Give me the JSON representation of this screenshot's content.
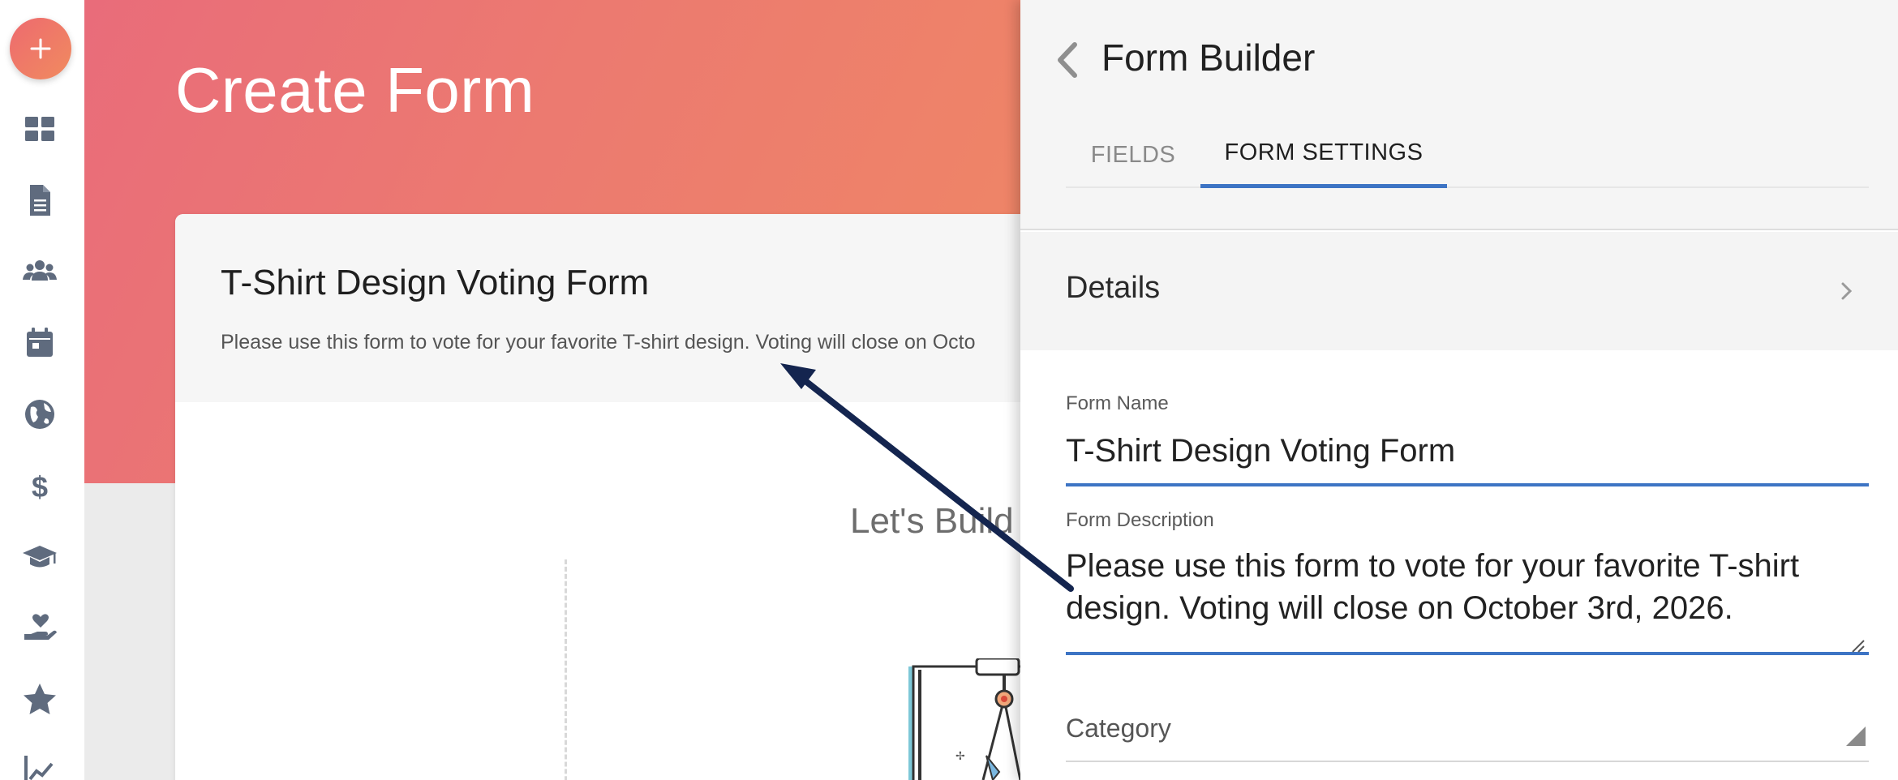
{
  "main": {
    "hero_title": "Create Form",
    "card_title": "T-Shirt Design Voting Form",
    "card_description": "Please use this form to vote for your favorite T-shirt design. Voting will close on Octo",
    "lets_build": "Let's Build"
  },
  "panel": {
    "title": "Form Builder",
    "tabs": [
      {
        "label": "FIELDS",
        "active": false
      },
      {
        "label": "FORM SETTINGS",
        "active": true
      }
    ],
    "details_label": "Details",
    "form_name_label": "Form Name",
    "form_name_value": "T-Shirt Design Voting Form",
    "form_description_label": "Form Description",
    "form_description_value": "Please use this form to vote for your favorite T-shirt design. Voting will close on October 3rd, 2026.",
    "category_label": "Category"
  },
  "rail": {
    "items": [
      "plus-icon",
      "dashboard-icon",
      "document-icon",
      "users-icon",
      "calendar-icon",
      "globe-icon",
      "dollar-icon",
      "graduation-cap-icon",
      "heart-hand-icon",
      "star-icon",
      "chart-icon"
    ]
  },
  "colors": {
    "accent": "#3d74c4",
    "hero_start": "#e96c7a",
    "hero_end": "#ef8765",
    "rail_icon": "#5f6b7e",
    "arrow": "#14254f"
  }
}
